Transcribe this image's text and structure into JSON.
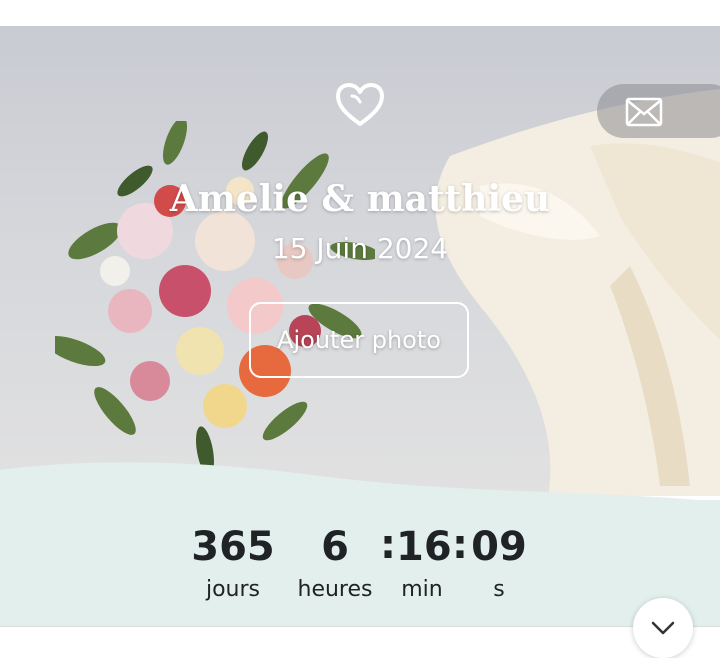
{
  "hero": {
    "couple_names": "Amelie & matthieu",
    "date": "15 Juin 2024",
    "add_photo_label": "Ajouter photo"
  },
  "countdown": {
    "days": {
      "value": "365",
      "label": "jours"
    },
    "hours": {
      "value": "6",
      "label": "heures"
    },
    "minutes": {
      "value": "16",
      "label": "min"
    },
    "seconds": {
      "value": "09",
      "label": "s"
    },
    "separator": ":"
  },
  "icons": {
    "heart": "heart-icon",
    "mail": "mail-icon",
    "scroll_down": "chevron-down-icon"
  },
  "colors": {
    "countdown_bg": "#e3efed",
    "text_dark": "#1f2325",
    "hero_text": "#ffffff"
  }
}
